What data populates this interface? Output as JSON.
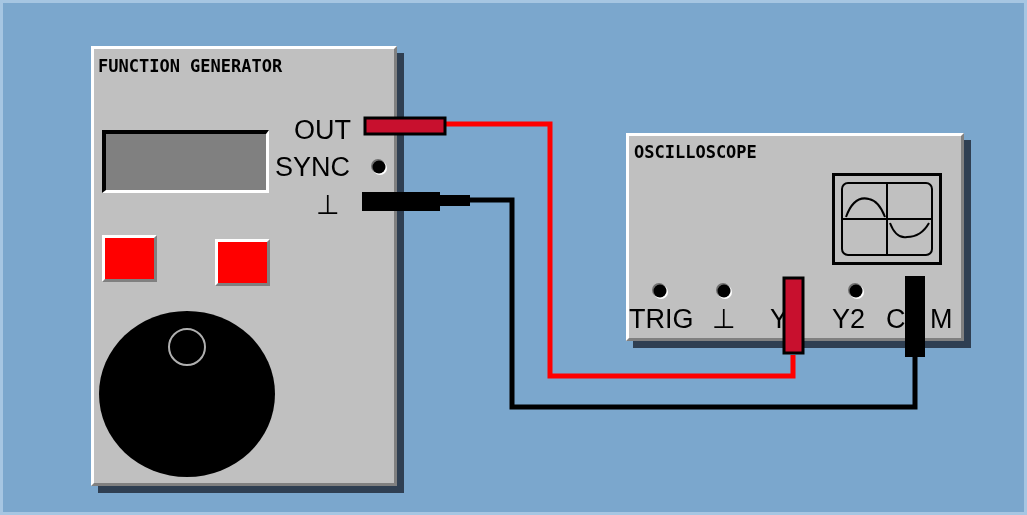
{
  "function_generator": {
    "title": "FUNCTION GENERATOR",
    "outputs": [
      {
        "label": "OUT",
        "plugged": true
      },
      {
        "label": "SYNC",
        "plugged": false
      },
      {
        "label": "⊥",
        "plugged": true
      }
    ]
  },
  "oscilloscope": {
    "title": "OSCILLOSCOPE",
    "inputs": [
      {
        "label": "TRIG",
        "plugged": false
      },
      {
        "label": "⊥",
        "plugged": false
      },
      {
        "label": [
          "Y"
        ],
        "plugged": true
      },
      {
        "label": "Y2",
        "plugged": false
      },
      {
        "label": [
          "C",
          "M"
        ],
        "plugged": true
      }
    ]
  },
  "cables": [
    {
      "color": "#ff0000"
    },
    {
      "color": "#000000"
    }
  ]
}
